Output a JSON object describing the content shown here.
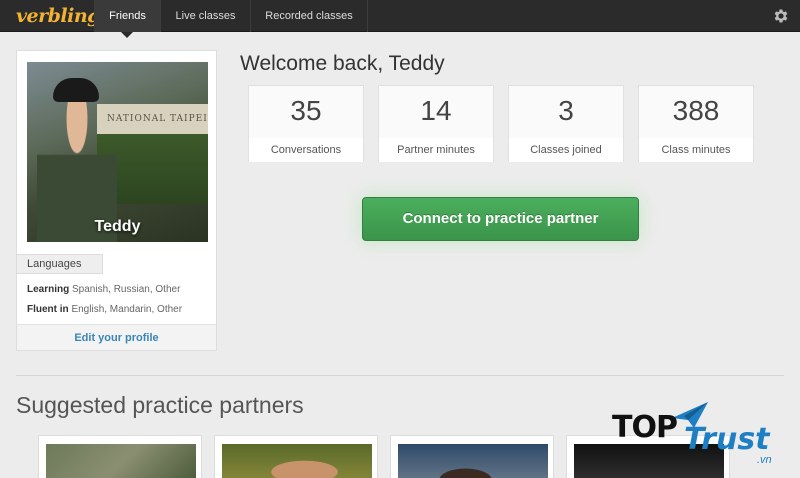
{
  "app": {
    "logo_text": "verbling"
  },
  "nav": {
    "tabs": [
      {
        "label": "Friends",
        "active": true
      },
      {
        "label": "Live classes",
        "active": false
      },
      {
        "label": "Recorded classes",
        "active": false
      }
    ],
    "settings_icon": "gear-icon"
  },
  "profile": {
    "name": "Teddy",
    "languages_label": "Languages",
    "learning_label": "Learning",
    "learning_value": "Spanish, Russian, Other",
    "fluent_label": "Fluent in",
    "fluent_value": "English, Mandarin, Other",
    "edit_link": "Edit your profile",
    "photo_sign_text": "NATIONAL TAIPEI UNIV"
  },
  "welcome": {
    "title": "Welcome back, Teddy",
    "stats": [
      {
        "value": "35",
        "label": "Conversations"
      },
      {
        "value": "14",
        "label": "Partner minutes"
      },
      {
        "value": "3",
        "label": "Classes joined"
      },
      {
        "value": "388",
        "label": "Class minutes"
      }
    ],
    "connect_button": "Connect to practice partner"
  },
  "suggested": {
    "title": "Suggested practice partners"
  },
  "watermark": {
    "top": "TOP",
    "trust": "Trust",
    "vn": ".vn"
  },
  "colors": {
    "accent_green": "#3f9e50",
    "link_blue": "#3a86b4",
    "nav_bg": "#2b2b2b",
    "logo_yellow": "#f2b233"
  }
}
